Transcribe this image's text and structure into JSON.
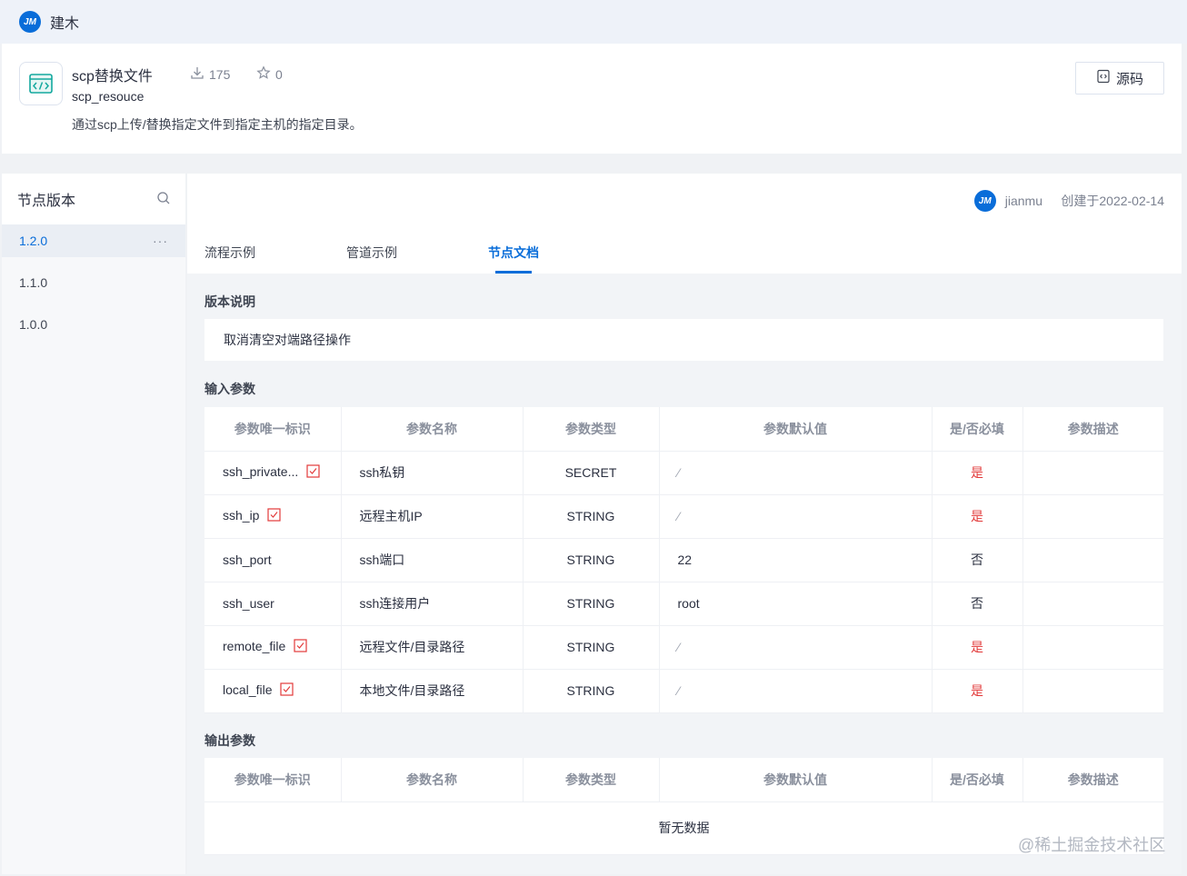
{
  "topbar": {
    "brand": "建木",
    "logo_text": "JM"
  },
  "node": {
    "title": "scp替换文件",
    "downloads": "175",
    "stars": "0",
    "ref": "scp_resouce",
    "description": "通过scp上传/替换指定文件到指定主机的指定目录。",
    "source_button": "源码"
  },
  "sidebar": {
    "title": "节点版本",
    "versions": [
      {
        "label": "1.2.0",
        "active": true
      },
      {
        "label": "1.1.0"
      },
      {
        "label": "1.0.0"
      }
    ],
    "more": "···"
  },
  "author": {
    "name": "jianmu",
    "created": "创建于2022-02-14"
  },
  "tabs": [
    "流程示例",
    "管道示例",
    "节点文档"
  ],
  "active_tab": "节点文档",
  "release": {
    "title": "版本说明",
    "text": "取消清空对端路径操作"
  },
  "inputs": {
    "title": "输入参数",
    "headers": [
      "参数唯一标识",
      "参数名称",
      "参数类型",
      "参数默认值",
      "是/否必填",
      "参数描述"
    ],
    "rows": [
      {
        "ref": "ssh_private...",
        "name": "ssh私钥",
        "type": "SECRET",
        "default": "⁄",
        "required": "是",
        "req_icon": true
      },
      {
        "ref": "ssh_ip",
        "name": "远程主机IP",
        "type": "STRING",
        "default": "⁄",
        "required": "是",
        "req_icon": true
      },
      {
        "ref": "ssh_port",
        "name": "ssh端口",
        "type": "STRING",
        "default": "22",
        "required": "否",
        "req_icon": false
      },
      {
        "ref": "ssh_user",
        "name": "ssh连接用户",
        "type": "STRING",
        "default": "root",
        "required": "否",
        "req_icon": false
      },
      {
        "ref": "remote_file",
        "name": "远程文件/目录路径",
        "type": "STRING",
        "default": "⁄",
        "required": "是",
        "req_icon": true
      },
      {
        "ref": "local_file",
        "name": "本地文件/目录路径",
        "type": "STRING",
        "default": "⁄",
        "required": "是",
        "req_icon": true
      }
    ]
  },
  "outputs": {
    "title": "输出参数",
    "headers": [
      "参数唯一标识",
      "参数名称",
      "参数类型",
      "参数默认值",
      "是/否必填",
      "参数描述"
    ],
    "empty_text": "暂无数据"
  },
  "watermark": "@稀土掘金技术社区"
}
